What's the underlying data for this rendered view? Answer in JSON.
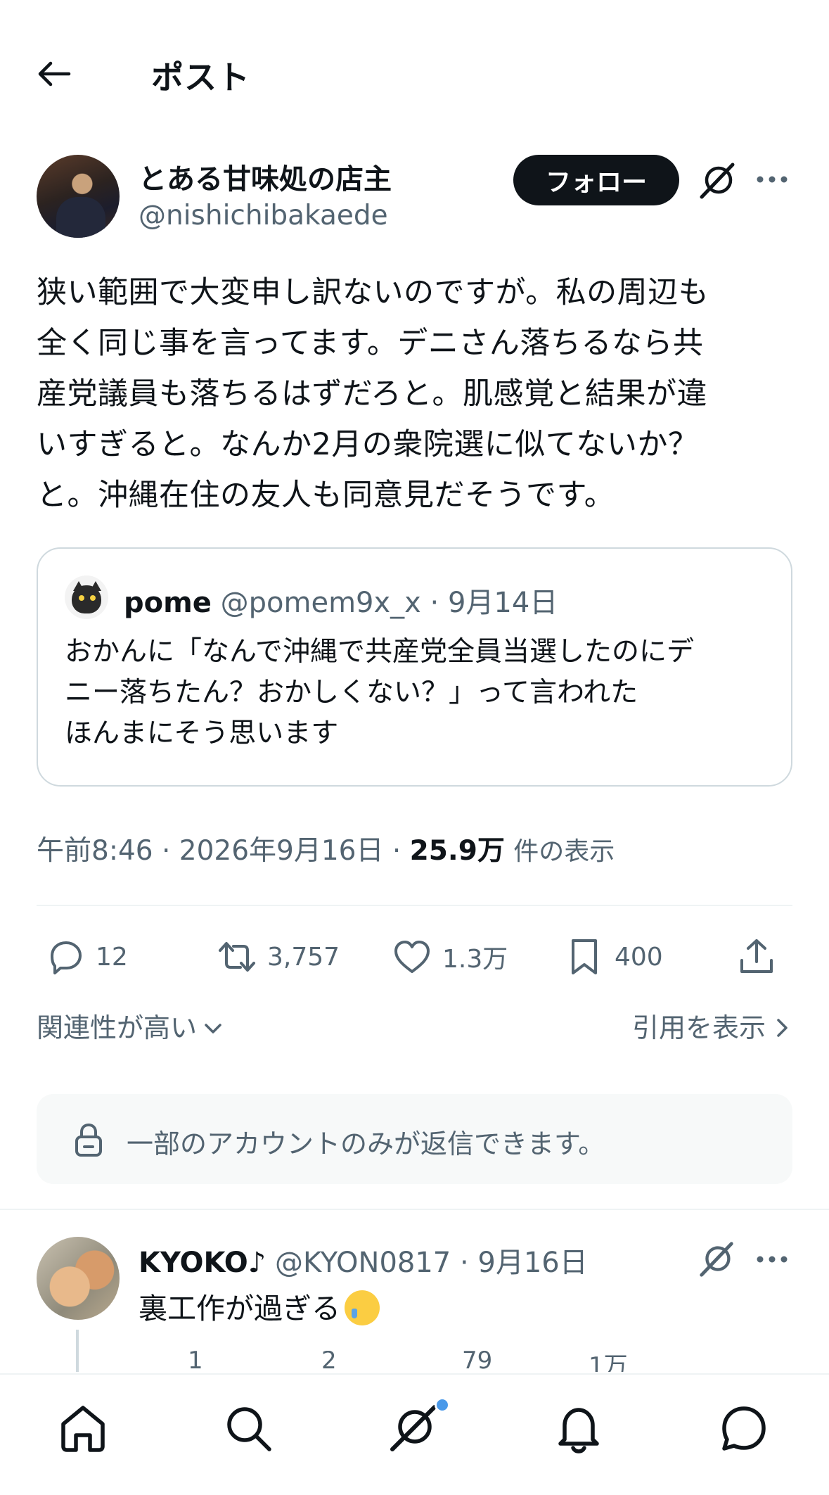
{
  "header": {
    "title": "ポスト"
  },
  "author": {
    "name": "とある甘味処の店主",
    "handle": "@nishichibakaede",
    "follow_label": "フォロー"
  },
  "post": {
    "text_lines": [
      "狭い範囲で大変申し訳ないのですが。私の周辺も",
      "全く同じ事を言ってます。デニさん落ちるなら共",
      "産党議員も落ちるはずだろと。肌感覚と結果が違",
      "いすぎると。なんか2月の衆院選に似てないか？",
      "と。沖縄在住の友人も同意見だそうです。"
    ],
    "timestamp": "午前8:46 · 2026年9月16日 · ",
    "views_count": "25.9万",
    "views_label": "件の表示"
  },
  "quote": {
    "name": "pome",
    "meta": "@pomem9x_x · 9月14日",
    "text_lines": [
      "おかんに「なんで沖縄で共産党全員当選したのにデ",
      "ニー落ちたん？おかしくない？」って言われた",
      "ほんまにそう思います"
    ]
  },
  "actions": {
    "replies": "12",
    "retweets": "3,757",
    "likes": "1.3万",
    "bookmarks": "400"
  },
  "sort": {
    "label": "関連性が高い"
  },
  "quotes_link": {
    "label": "引用を表示"
  },
  "restricted": {
    "text": "一部のアカウントのみが返信できます。"
  },
  "reply": {
    "name": "KYOKO♪",
    "meta": " @KYON0817 · 9月16日",
    "text": "裏工作が過ぎる",
    "emoji": "crying-face-emoji",
    "peek_actions": [
      "1",
      "2",
      "79",
      "1万"
    ]
  },
  "colors": {
    "text": "#0f1419",
    "secondary": "#536471",
    "border": "#cfd9de",
    "divider": "#eff3f4",
    "accent_dot": "#4a99e9"
  },
  "icons": [
    "back-arrow-icon",
    "grok-icon",
    "more-icon",
    "reply-icon",
    "retweet-icon",
    "heart-icon",
    "bookmark-icon",
    "share-icon",
    "chevron-down-icon",
    "chevron-right-icon",
    "lock-icon",
    "home-icon",
    "search-icon",
    "notifications-icon",
    "messages-icon"
  ]
}
